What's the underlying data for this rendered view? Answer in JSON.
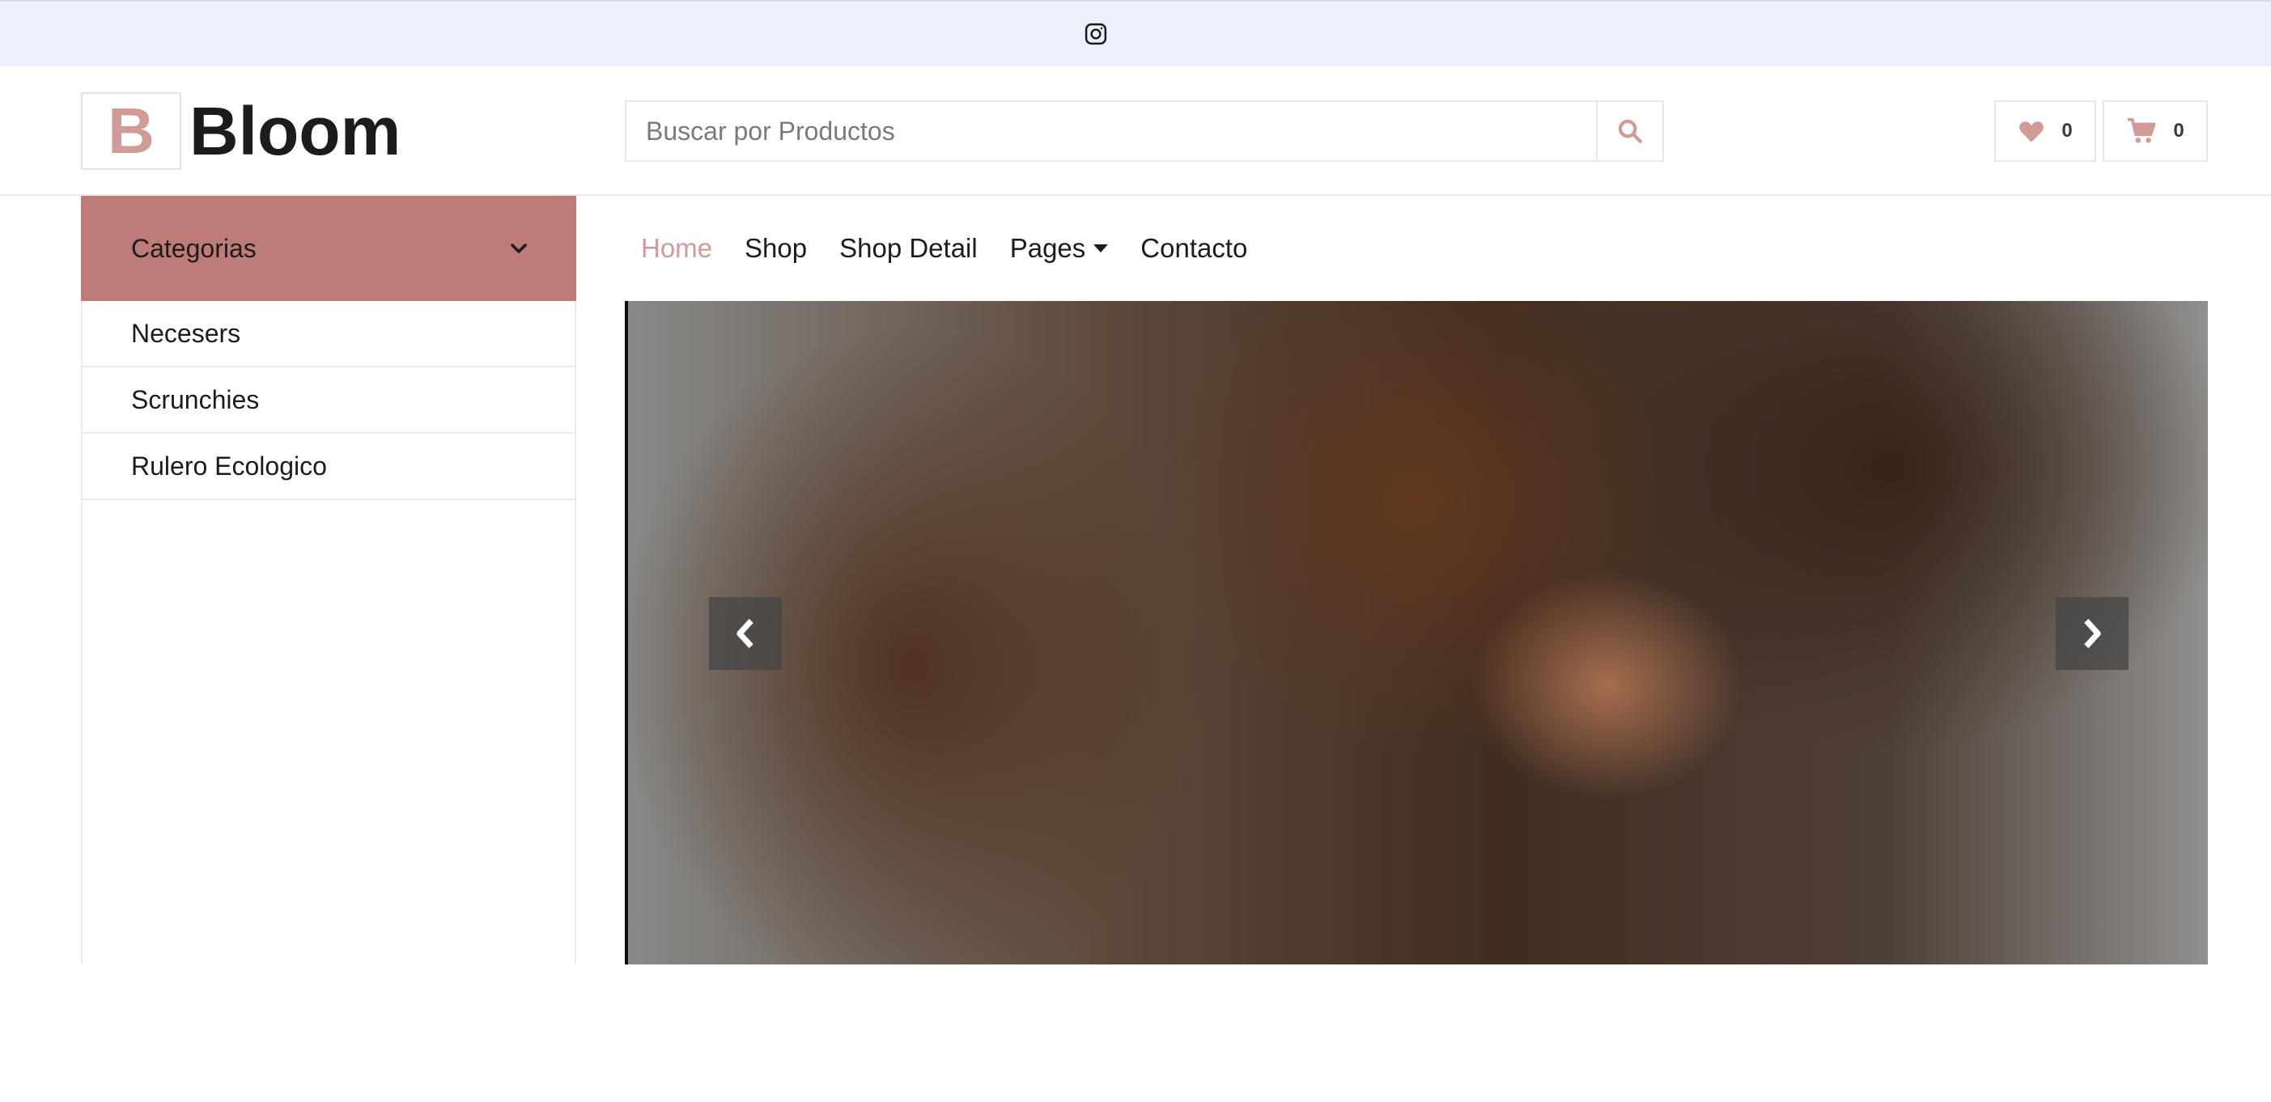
{
  "topbar": {
    "icon": "instagram-icon"
  },
  "header": {
    "logo_letter": "B",
    "logo_text": "Bloom",
    "search_placeholder": "Buscar por Productos",
    "search_icon": "search-icon",
    "wishlist": {
      "icon": "heart-icon",
      "count": "0"
    },
    "cart": {
      "icon": "cart-icon",
      "count": "0"
    }
  },
  "sidebar": {
    "header_label": "Categorias",
    "header_icon": "chevron-down-icon",
    "items": [
      {
        "label": "Necesers"
      },
      {
        "label": "Scrunchies"
      },
      {
        "label": "Rulero Ecologico"
      }
    ]
  },
  "nav": {
    "items": [
      {
        "label": "Home",
        "active": true
      },
      {
        "label": "Shop"
      },
      {
        "label": "Shop Detail"
      },
      {
        "label": "Pages",
        "dropdown": true
      },
      {
        "label": "Contacto"
      }
    ]
  },
  "carousel": {
    "prev_icon": "chevron-left-icon",
    "next_icon": "chevron-right-icon"
  },
  "colors": {
    "accent": "#d19c97",
    "category_bg": "#bf7b77",
    "topbar_bg": "#edf1fd"
  }
}
